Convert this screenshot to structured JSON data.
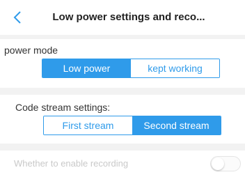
{
  "header": {
    "title": "Low power settings and reco...",
    "back_icon": "chevron-left-icon"
  },
  "power_mode": {
    "label": "power mode",
    "options": [
      "Low power",
      "kept working"
    ],
    "selected": "Low power"
  },
  "code_stream": {
    "label": "Code stream settings:",
    "options": [
      "First stream",
      "Second stream"
    ],
    "selected": "Second stream"
  },
  "recording": {
    "label": "Whether to enable recording",
    "enabled": false,
    "disabled_row": true
  },
  "colors": {
    "accent": "#2f9bea",
    "section_gap": "#f2f2f2",
    "disabled_text": "#c9c9c9"
  }
}
